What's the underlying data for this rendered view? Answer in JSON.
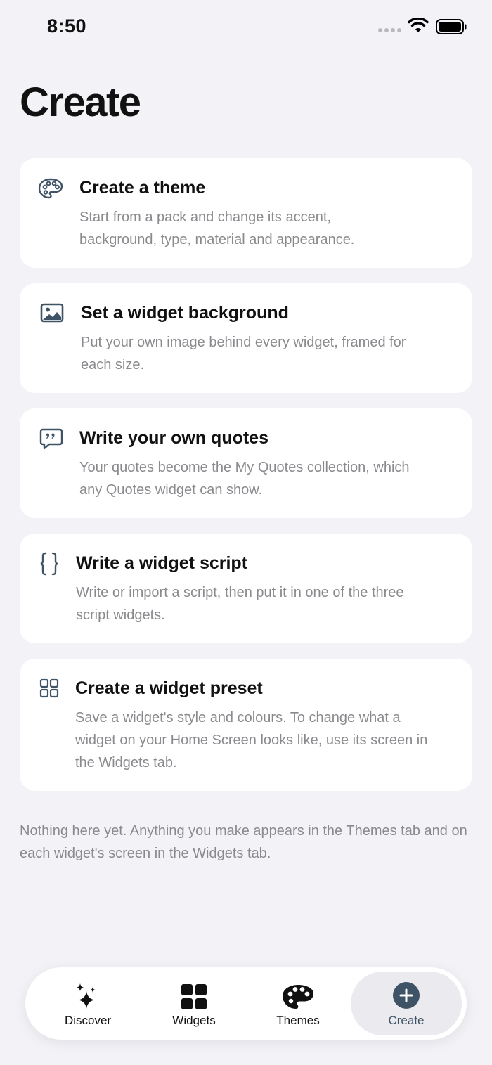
{
  "status_bar": {
    "time": "8:50"
  },
  "page": {
    "title": "Create"
  },
  "cards": [
    {
      "title": "Create a theme",
      "description": "Start from a pack and change its accent, background, type, material and appearance.",
      "icon": "palette-outline-icon"
    },
    {
      "title": "Set a widget background",
      "description": "Put your own image behind every widget, framed for each size.",
      "icon": "photo-icon"
    },
    {
      "title": "Write your own quotes",
      "description": "Your quotes become the My Quotes collection, which any Quotes widget can show.",
      "icon": "quote-bubble-icon"
    },
    {
      "title": "Write a widget script",
      "description": "Write or import a script, then put it in one of the three script widgets.",
      "icon": "curly-braces-icon"
    },
    {
      "title": "Create a widget preset",
      "description": "Save a widget's style and colours. To change what a widget on your Home Screen looks like, use its screen in the Widgets tab.",
      "icon": "grid-outline-icon"
    }
  ],
  "empty_note": "Nothing here yet. Anything you make appears in the Themes tab and on each widget's screen in the Widgets tab.",
  "tab_bar": {
    "tabs": [
      {
        "label": "Discover",
        "icon": "sparkles-icon"
      },
      {
        "label": "Widgets",
        "icon": "grid-icon"
      },
      {
        "label": "Themes",
        "icon": "palette-icon"
      },
      {
        "label": "Create",
        "icon": "plus-circle-icon",
        "selected": true
      }
    ]
  },
  "colors": {
    "background": "#f2f2f7",
    "card": "#ffffff",
    "icon_accent": "#3f5366",
    "secondary_text": "#8a8a8e"
  }
}
